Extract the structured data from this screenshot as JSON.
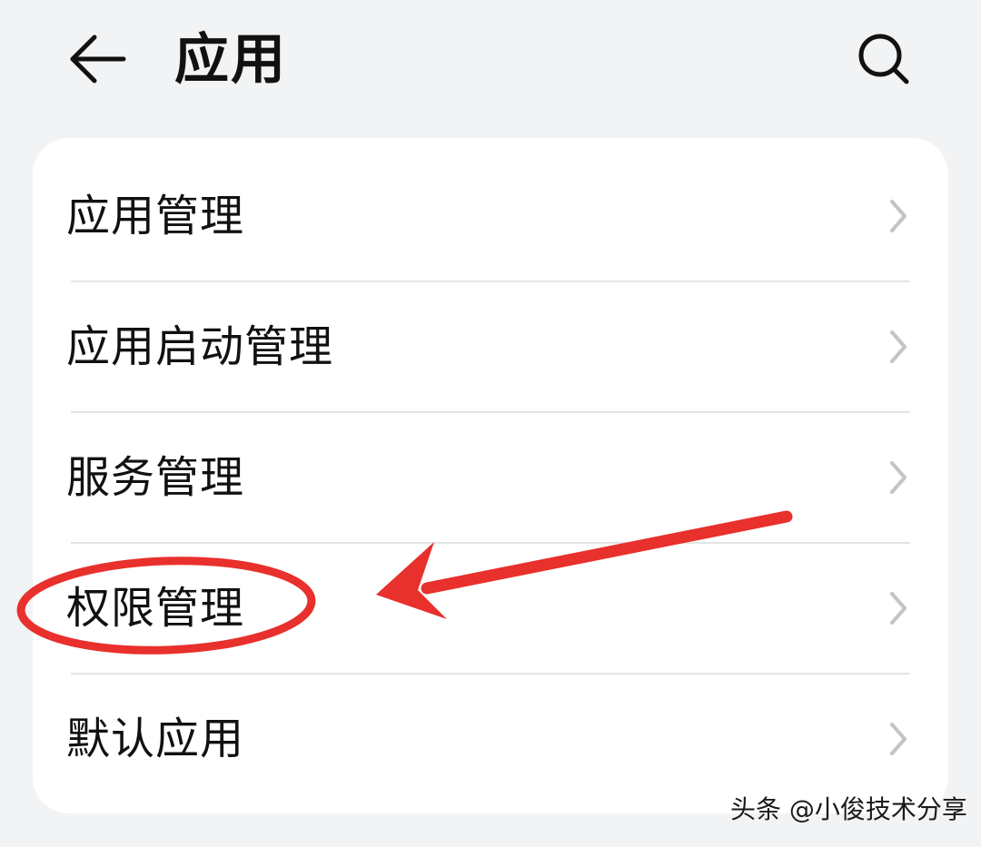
{
  "header": {
    "title": "应用",
    "back_icon": "arrow-left-icon",
    "search_icon": "search-icon"
  },
  "menu": {
    "items": [
      {
        "label": "应用管理",
        "icon": "chevron-right-icon"
      },
      {
        "label": "应用启动管理",
        "icon": "chevron-right-icon"
      },
      {
        "label": "服务管理",
        "icon": "chevron-right-icon"
      },
      {
        "label": "权限管理",
        "icon": "chevron-right-icon",
        "highlighted": true
      },
      {
        "label": "默认应用",
        "icon": "chevron-right-icon"
      }
    ]
  },
  "annotation": {
    "type": "red-circle-and-arrow",
    "color": "#e8302c",
    "target": "权限管理"
  },
  "watermark": "头条 @小俊技术分享",
  "colors": {
    "background": "#f1f3f5",
    "card": "#ffffff",
    "text": "#111111",
    "chevron": "#c4c4c4",
    "annotation": "#e8302c"
  }
}
